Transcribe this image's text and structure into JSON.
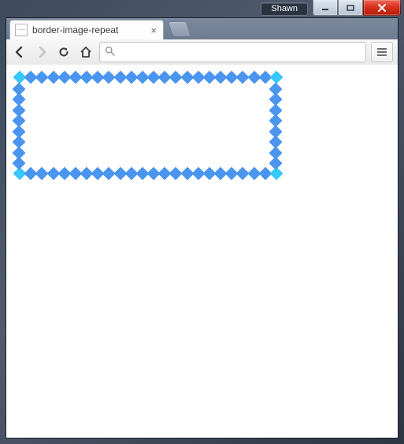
{
  "window": {
    "user_badge": "Shawn"
  },
  "browser": {
    "tab_title": "border-image-repeat",
    "omnibox_value": "",
    "omnibox_placeholder": ""
  },
  "colors": {
    "border_edge": "#4a95ef",
    "border_corner": "#38c8fb"
  }
}
